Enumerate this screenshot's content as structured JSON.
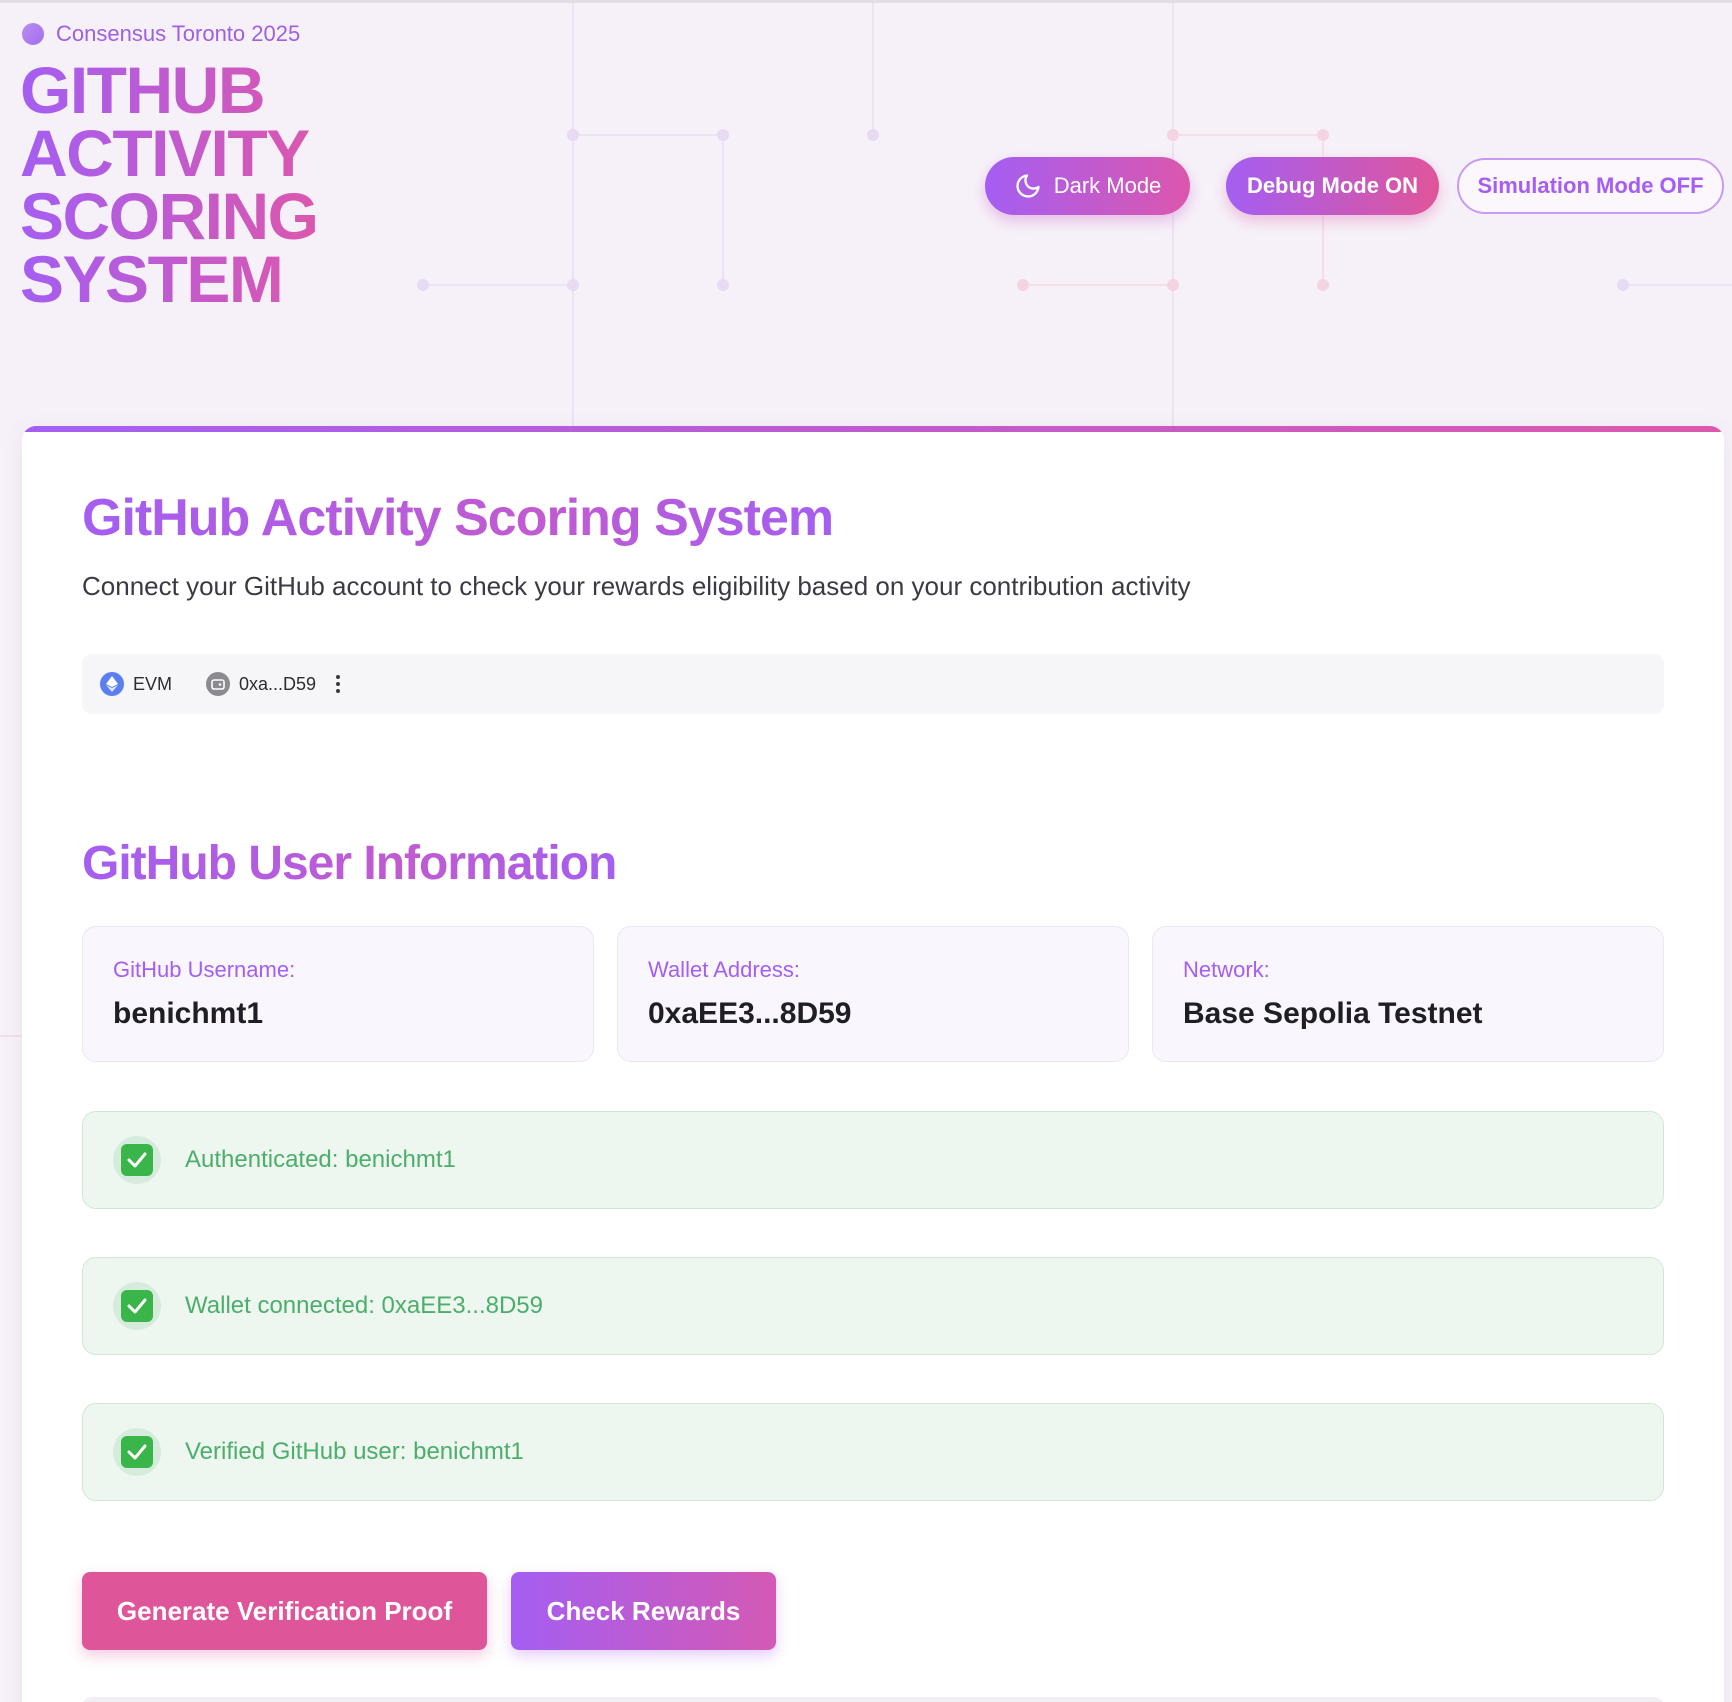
{
  "header": {
    "event_label": "Consensus Toronto 2025",
    "hero_title_lines": [
      "GITHUB",
      "ACTIVITY",
      "SCORING",
      "SYSTEM"
    ],
    "dark_mode_label": "Dark Mode",
    "debug_mode_label": "Debug Mode ON",
    "simulation_mode_label": "Simulation Mode OFF"
  },
  "main": {
    "title": "GitHub Activity Scoring System",
    "subtitle": "Connect your GitHub account to check your rewards eligibility based on your contribution activity",
    "wallet_bar": {
      "chain_label": "EVM",
      "address_short": "0xa...D59"
    },
    "user_info": {
      "section_title": "GitHub User Information",
      "cards": [
        {
          "label": "GitHub Username:",
          "value": "benichmt1"
        },
        {
          "label": "Wallet Address:",
          "value": "0xaEE3...8D59"
        },
        {
          "label": "Network:",
          "value": "Base Sepolia Testnet"
        }
      ]
    },
    "statuses": [
      {
        "text": "Authenticated: benichmt1"
      },
      {
        "text": "Wallet connected: 0xaEE3...8D59"
      },
      {
        "text": "Verified GitHub user: benichmt1"
      }
    ],
    "actions": {
      "generate_proof_label": "Generate Verification Proof",
      "check_rewards_label": "Check Rewards"
    }
  },
  "colors": {
    "accent_purple": "#a45ef2",
    "accent_pink": "#dc57ad",
    "success_green": "#4cae6b",
    "success_bg": "#eef6f0"
  },
  "icons": {
    "brand_dot": "circle-dot-icon",
    "dark_mode": "moon-icon",
    "chain": "ethereum-icon",
    "wallet": "wallet-icon",
    "more": "vertical-dots-icon",
    "status": "check-box-icon"
  }
}
